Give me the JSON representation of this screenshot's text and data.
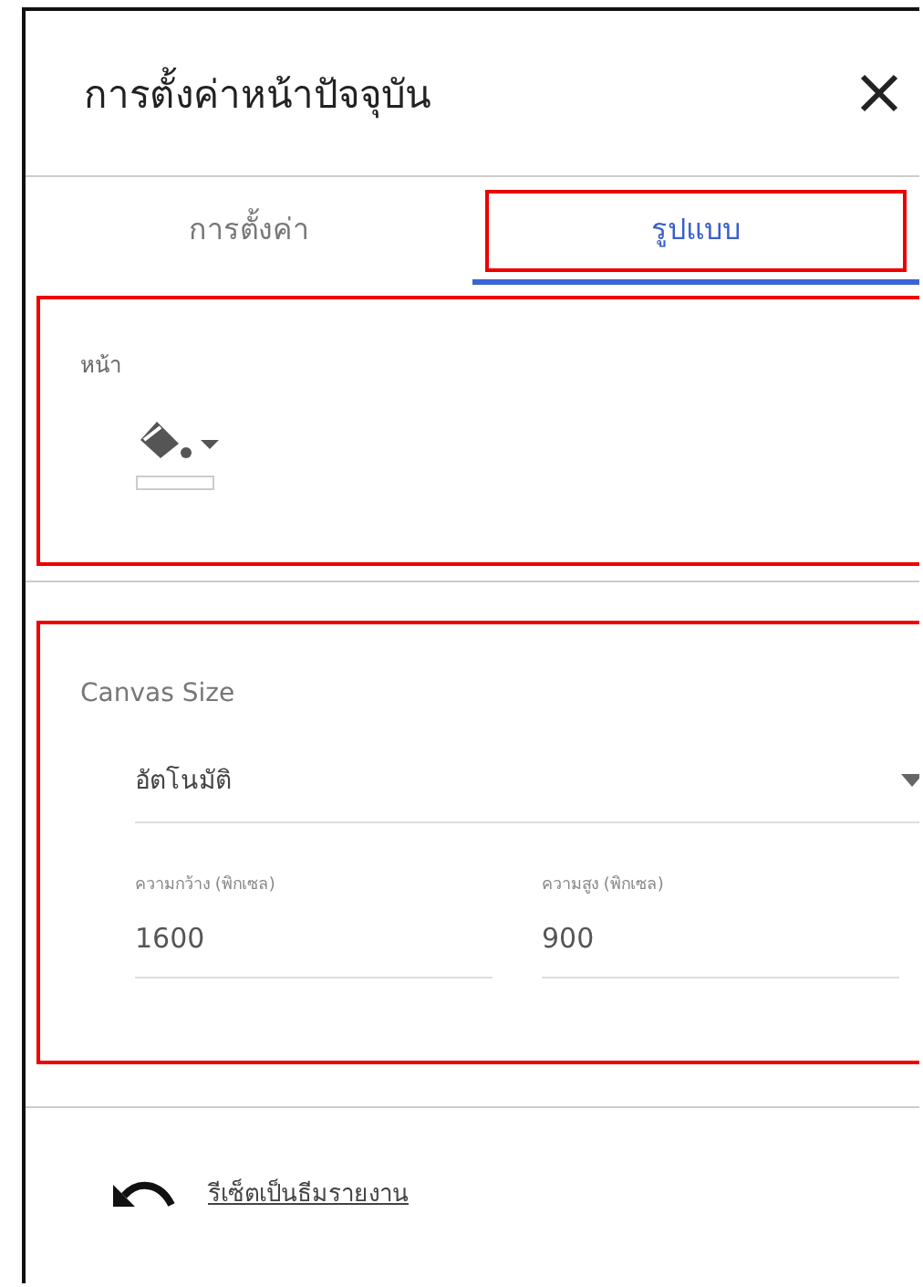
{
  "panel": {
    "title": "การตั้งค่าหน้าปัจจุบัน"
  },
  "tabs": [
    {
      "label": "การตั้งค่า",
      "selected": false,
      "highlighted": false
    },
    {
      "label": "รูปแบบ",
      "selected": true,
      "highlighted": true
    }
  ],
  "page_section": {
    "label": "หน้า",
    "highlighted": true
  },
  "canvas_size": {
    "heading": "Canvas Size",
    "highlighted": true,
    "mode": {
      "value": "อัตโนมัติ"
    },
    "width": {
      "label": "ความกว้าง (พิกเซล)",
      "value": "1600"
    },
    "height": {
      "label": "ความสูง (พิกเซล)",
      "value": "900"
    }
  },
  "reset": {
    "label": "รีเซ็ตเป็นธีมรายงาน"
  }
}
